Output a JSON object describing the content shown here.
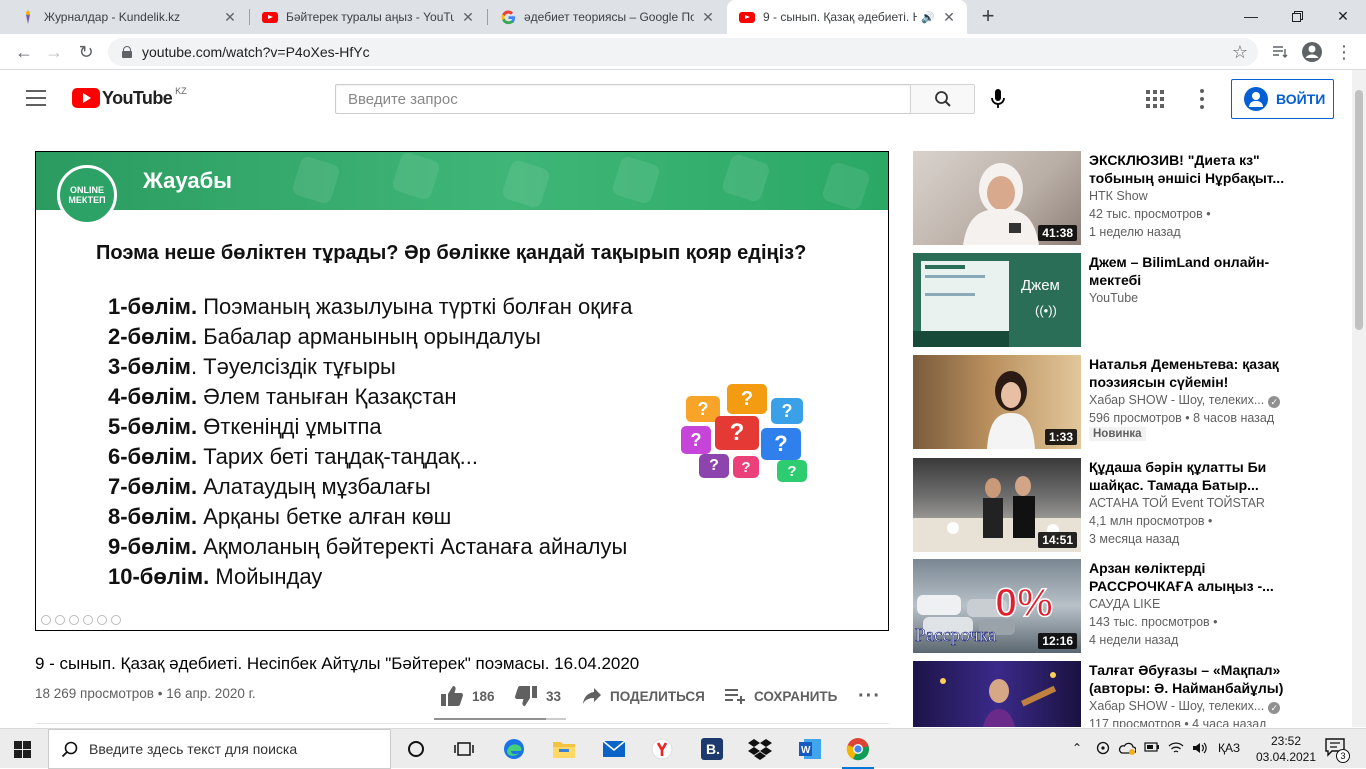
{
  "browser": {
    "tabs": [
      {
        "title": "Журналдар - Kundelik.kz",
        "icon": "kundelik-icon",
        "active": false
      },
      {
        "title": "Бәйтерек туралы аңыз - YouTube",
        "icon": "youtube-icon",
        "active": false
      },
      {
        "title": "әдебиет теориясы – Google Поиск",
        "icon": "google-icon",
        "active": false
      },
      {
        "title": "9 - сынып. Қазақ әдебиеті. Н",
        "icon": "youtube-icon",
        "active": true
      }
    ],
    "url": "youtube.com/watch?v=P4oXes-HfYc"
  },
  "youtube": {
    "logo_text": "YouTube",
    "country_code": "KZ",
    "search_placeholder": "Введите запрос",
    "signin_label": "ВОЙТИ"
  },
  "slide": {
    "band_title": "Жауабы",
    "logo_line1": "ONLINE",
    "logo_line2": "МЕКТЕП",
    "question": "Поэма неше бөліктен тұрады? Әр бөлікке қандай тақырып қояр едіңіз?",
    "parts": [
      {
        "num": "1-бөлім.",
        "text": " Поэманың жазылуына түрткі болған оқиға"
      },
      {
        "num": "2-бөлім.",
        "text": " Бабалар арманының орындалуы"
      },
      {
        "num": "3-бөлім",
        "text": ". Тәуелсіздік тұғыры"
      },
      {
        "num": "4-бөлім.",
        "text": " Әлем таныған Қазақстан"
      },
      {
        "num": "5-бөлім.",
        "text": " Өткеніңді ұмытпа"
      },
      {
        "num": "6-бөлім.",
        "text": " Тарих беті таңдақ-таңдақ..."
      },
      {
        "num": "7-бөлім.",
        "text": " Алатаудың мұзбалағы"
      },
      {
        "num": "8-бөлім.",
        "text": " Арқаны бетке алған көш"
      },
      {
        "num": "9-бөлім.",
        "text": " Ақмоланың бәйтеректі Астанаға айналуы"
      },
      {
        "num": "10-бөлім.",
        "text": " Мойындау"
      }
    ]
  },
  "video": {
    "title": "9 - сынып. Қазақ әдебиеті. Несіпбек Айтұлы \"Бәйтерек\" поэмасы. 16.04.2020",
    "meta": "18 269 просмотров • 16 апр. 2020 г.",
    "likes": "186",
    "dislikes": "33",
    "share_label": "ПОДЕЛИТЬСЯ",
    "save_label": "СОХРАНИТЬ",
    "like_ratio": 0.85
  },
  "recommendations": [
    {
      "title": "ЭКСКЛЮЗИВ! \"Диета кз\" тобының әншісі Нұрбақыт...",
      "channel": "НТК Show",
      "verified": false,
      "line2": "42 тыс. просмотров •",
      "line3": "1 неделю назад",
      "duration": "41:38"
    },
    {
      "title": "Джем – BilimLand онлайн-мектебі",
      "channel": "YouTube",
      "verified": false,
      "line2": "",
      "line3": "",
      "duration": "",
      "thumb_label": "Джем"
    },
    {
      "title": "Наталья Деменьтева: қазақ поэзиясын сүйемін!",
      "channel": "Хабар SHOW - Шоу, телеких...",
      "verified": true,
      "line2": "596 просмотров • 8 часов назад",
      "line3": "",
      "badge": "Новинка",
      "duration": "1:33"
    },
    {
      "title": "Құдаша бәрін құлатты Би шайқас. Тамада Батыр...",
      "channel": "АСТАНА ТОЙ Event ТОЙSTAR",
      "verified": false,
      "line2": "4,1 млн просмотров •",
      "line3": "3 месяца назад",
      "duration": "14:51"
    },
    {
      "title": "Арзан көліктерді РАССРОЧКАҒА алыңыз -...",
      "channel": "САУДА LIKE",
      "verified": false,
      "line2": "143 тыс. просмотров •",
      "line3": "4 недели назад",
      "duration": "12:16",
      "thumb_label": "0%",
      "thumb_label2": "Рассрочка"
    },
    {
      "title": "Талғат Әбуғазы – «Мақпал» (авторы: Ә. Найманбайұлы)",
      "channel": "Хабар SHOW - Шоу, телеких...",
      "verified": true,
      "line2": "117 просмотров • 4 часа назад",
      "line3": "",
      "duration": ""
    }
  ],
  "taskbar": {
    "search_placeholder": "Введите здесь текст для поиска",
    "language": "ҚАЗ",
    "time": "23:52",
    "date": "03.04.2021",
    "notification_count": "3"
  },
  "colors": {
    "accent_blue": "#065fd4",
    "youtube_red": "#ff0000",
    "slide_green": "#2fa86a"
  }
}
